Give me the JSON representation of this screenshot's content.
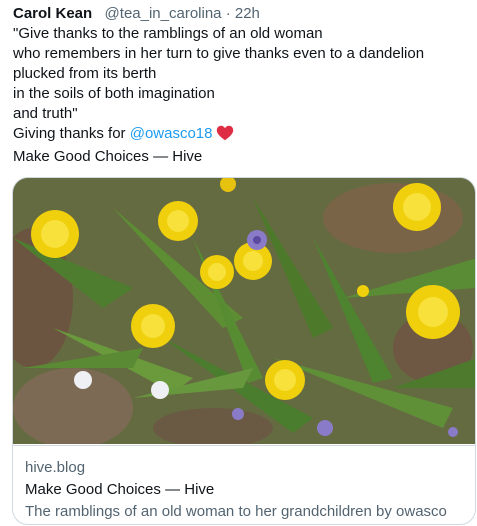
{
  "tweet": {
    "author_name": "Carol Kean",
    "author_handle": "@tea_in_carolina",
    "separator": "·",
    "time": "22h",
    "lines": [
      "\"Give thanks to the ramblings of an old woman",
      "who remembers in her turn to give thanks even to a dandelion",
      "plucked from its berth",
      "in the soils of both imagination",
      "and truth\""
    ],
    "thanks_prefix": "Giving thanks for ",
    "mention": "@owasco18",
    "last_line": "Make Good Choices — Hive",
    "heart_icon": "red-heart-icon"
  },
  "card": {
    "image_icon": "dandelion-photo",
    "domain": "hive.blog",
    "title": "Make Good Choices — Hive",
    "description": "The ramblings of an old woman to her grandchildren by owasco"
  },
  "colors": {
    "text": "#0f1419",
    "secondary": "#536471",
    "link": "#1d9bf0",
    "border": "#cfd9de",
    "heart": "#e0245e"
  }
}
